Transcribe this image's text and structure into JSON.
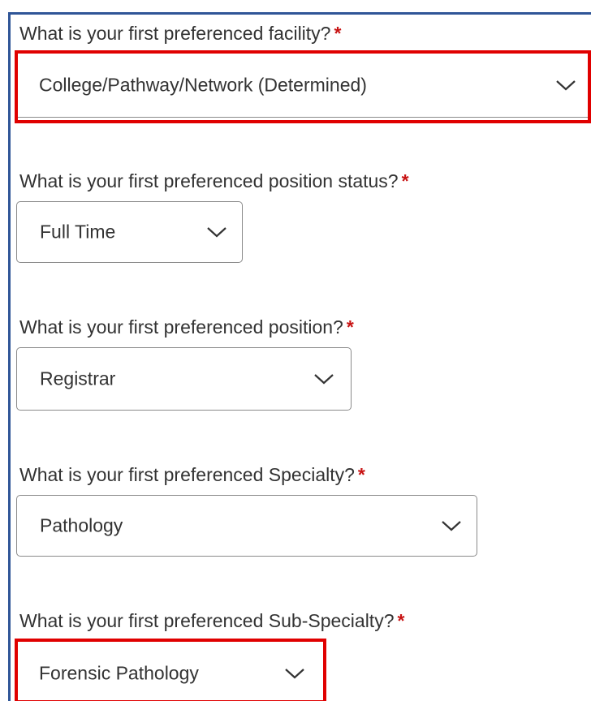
{
  "required_marker": "*",
  "fields": [
    {
      "question": "What is your first preferenced facility?",
      "value": "College/Pathway/Network (Determined)",
      "highlighted": true
    },
    {
      "question": "What is your first preferenced position status?",
      "value": "Full Time",
      "highlighted": false
    },
    {
      "question": "What is your first preferenced position?",
      "value": "Registrar",
      "highlighted": false
    },
    {
      "question": "What is your first preferenced Specialty?",
      "value": "Pathology",
      "highlighted": false
    },
    {
      "question": "What is your first preferenced Sub-Specialty?",
      "value": "Forensic Pathology",
      "highlighted": true
    }
  ],
  "colors": {
    "highlight": "#e00000",
    "required": "#c81414",
    "frame": "#2f5597"
  },
  "icons": {
    "dropdown": "chevron-down-icon"
  }
}
